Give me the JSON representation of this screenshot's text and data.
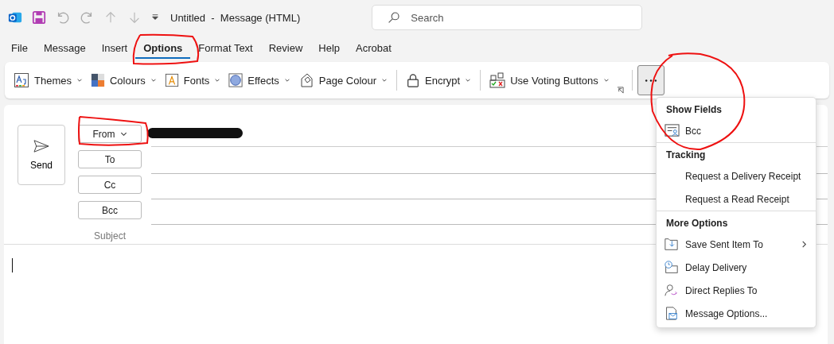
{
  "title_bar": {
    "title": "Untitled  -  Message (HTML)",
    "search": {
      "placeholder": "Search"
    }
  },
  "tabs": [
    {
      "label": "File",
      "selected": false
    },
    {
      "label": "Message",
      "selected": false
    },
    {
      "label": "Insert",
      "selected": false
    },
    {
      "label": "Options",
      "selected": true
    },
    {
      "label": "Format Text",
      "selected": false
    },
    {
      "label": "Review",
      "selected": false
    },
    {
      "label": "Help",
      "selected": false
    },
    {
      "label": "Acrobat",
      "selected": false
    }
  ],
  "ribbon": {
    "groups": [
      [
        {
          "label": "Themes",
          "kind": "themes"
        },
        {
          "label": "Colours",
          "kind": "colours"
        },
        {
          "label": "Fonts",
          "kind": "fonts"
        },
        {
          "label": "Effects",
          "kind": "effects"
        },
        {
          "label": "Page Colour",
          "kind": "page"
        }
      ],
      [
        {
          "label": "Encrypt",
          "kind": "lock"
        }
      ],
      [
        {
          "label": "Use Voting Buttons",
          "kind": "voting"
        }
      ]
    ]
  },
  "compose": {
    "send": "Send",
    "fields": [
      {
        "label": "From",
        "kind": "from"
      },
      {
        "label": "To",
        "kind": "button"
      },
      {
        "label": "Cc",
        "kind": "button"
      },
      {
        "label": "Bcc",
        "kind": "button"
      },
      {
        "label": "Subject",
        "kind": "plain"
      }
    ]
  },
  "menu": {
    "sections": [
      {
        "title": "Show Fields",
        "items": [
          {
            "label": "Bcc",
            "kind": "bcc",
            "submenu": false
          }
        ]
      },
      {
        "title": "Tracking",
        "items": [
          {
            "label": "Request a Delivery Receipt",
            "submenu": false
          },
          {
            "label": "Request a Read Receipt",
            "submenu": false
          }
        ]
      },
      {
        "title": "More Options",
        "items": [
          {
            "label": "Save Sent Item To",
            "kind": "save",
            "submenu": true
          },
          {
            "label": "Delay Delivery",
            "kind": "delay",
            "submenu": false
          },
          {
            "label": "Direct Replies To",
            "kind": "replies",
            "submenu": false
          },
          {
            "label": "Message Options...",
            "kind": "options",
            "submenu": false
          }
        ]
      }
    ]
  }
}
